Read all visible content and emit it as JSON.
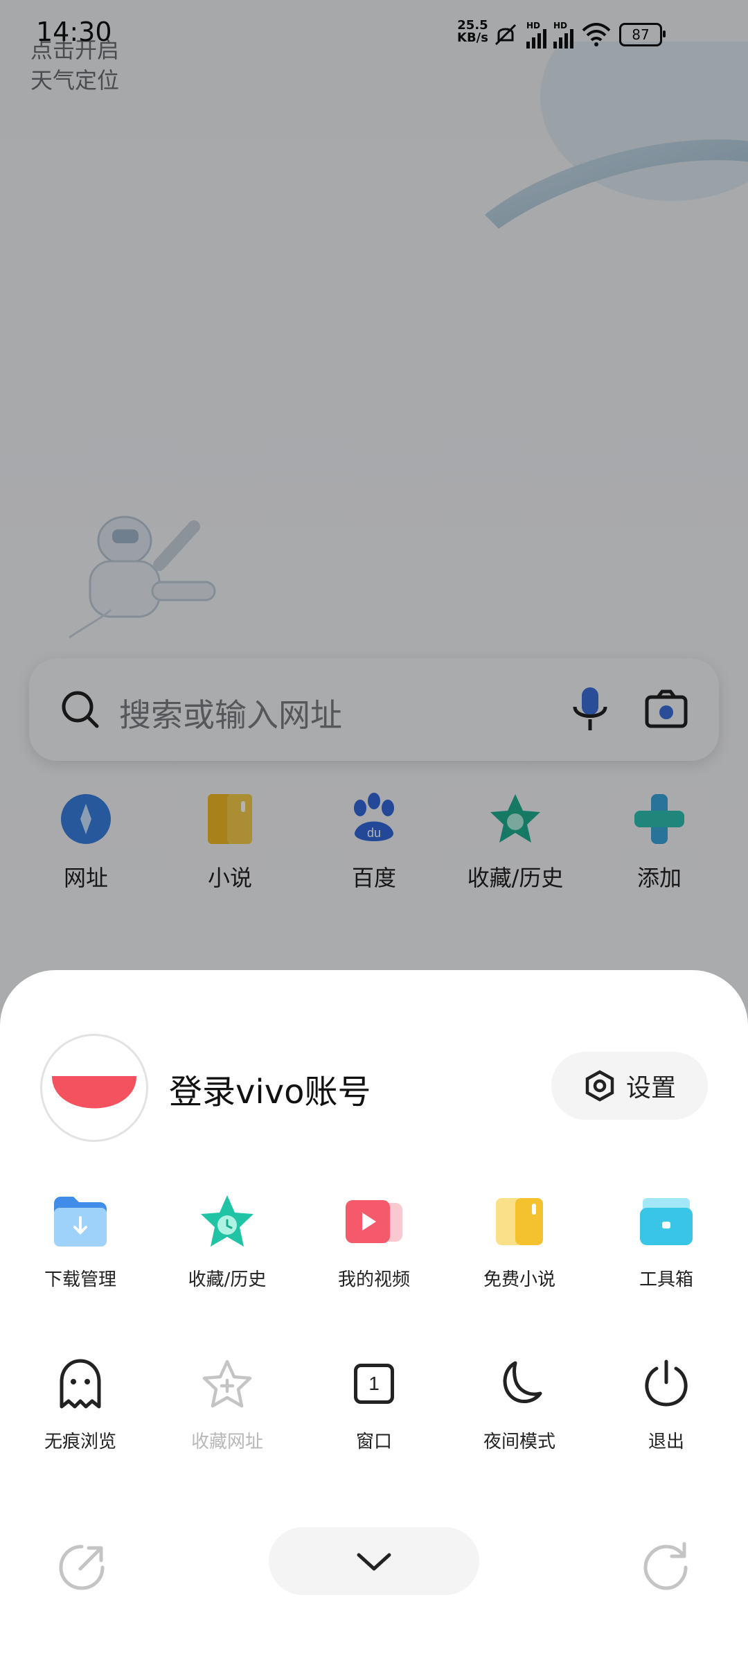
{
  "status_bar": {
    "time": "14:30",
    "net_speed_value": "25.5",
    "net_speed_unit": "KB/s",
    "signal1_label": "HD",
    "signal2_label": "HD",
    "battery": "87"
  },
  "background": {
    "weather_tip_line1": "点击开启",
    "weather_tip_line2": "天气定位",
    "search_placeholder": "搜索或输入网址",
    "shortcuts": [
      {
        "label": "网址",
        "icon": "compass-icon"
      },
      {
        "label": "小说",
        "icon": "book-icon"
      },
      {
        "label": "百度",
        "icon": "baidu-paw-icon"
      },
      {
        "label": "收藏/历史",
        "icon": "star-clock-icon"
      },
      {
        "label": "添加",
        "icon": "plus-icon"
      }
    ]
  },
  "sheet": {
    "login_label": "登录vivo账号",
    "settings_label": "设置",
    "row1": [
      {
        "label": "下载管理",
        "icon": "download-folder-icon"
      },
      {
        "label": "收藏/历史",
        "icon": "star-clock-icon"
      },
      {
        "label": "我的视频",
        "icon": "video-icon"
      },
      {
        "label": "免费小说",
        "icon": "book-icon"
      },
      {
        "label": "工具箱",
        "icon": "toolbox-icon"
      }
    ],
    "row2": [
      {
        "label": "无痕浏览",
        "icon": "ghost-icon"
      },
      {
        "label": "收藏网址",
        "icon": "star-plus-icon"
      },
      {
        "label": "窗口",
        "icon": "window-count-icon",
        "count": "1"
      },
      {
        "label": "夜间模式",
        "icon": "moon-icon"
      },
      {
        "label": "退出",
        "icon": "power-icon"
      }
    ]
  },
  "colors": {
    "accent_red": "#f4525f",
    "teal": "#2fc9b0",
    "blue": "#5aa7f0",
    "yellow": "#f5c23a"
  }
}
